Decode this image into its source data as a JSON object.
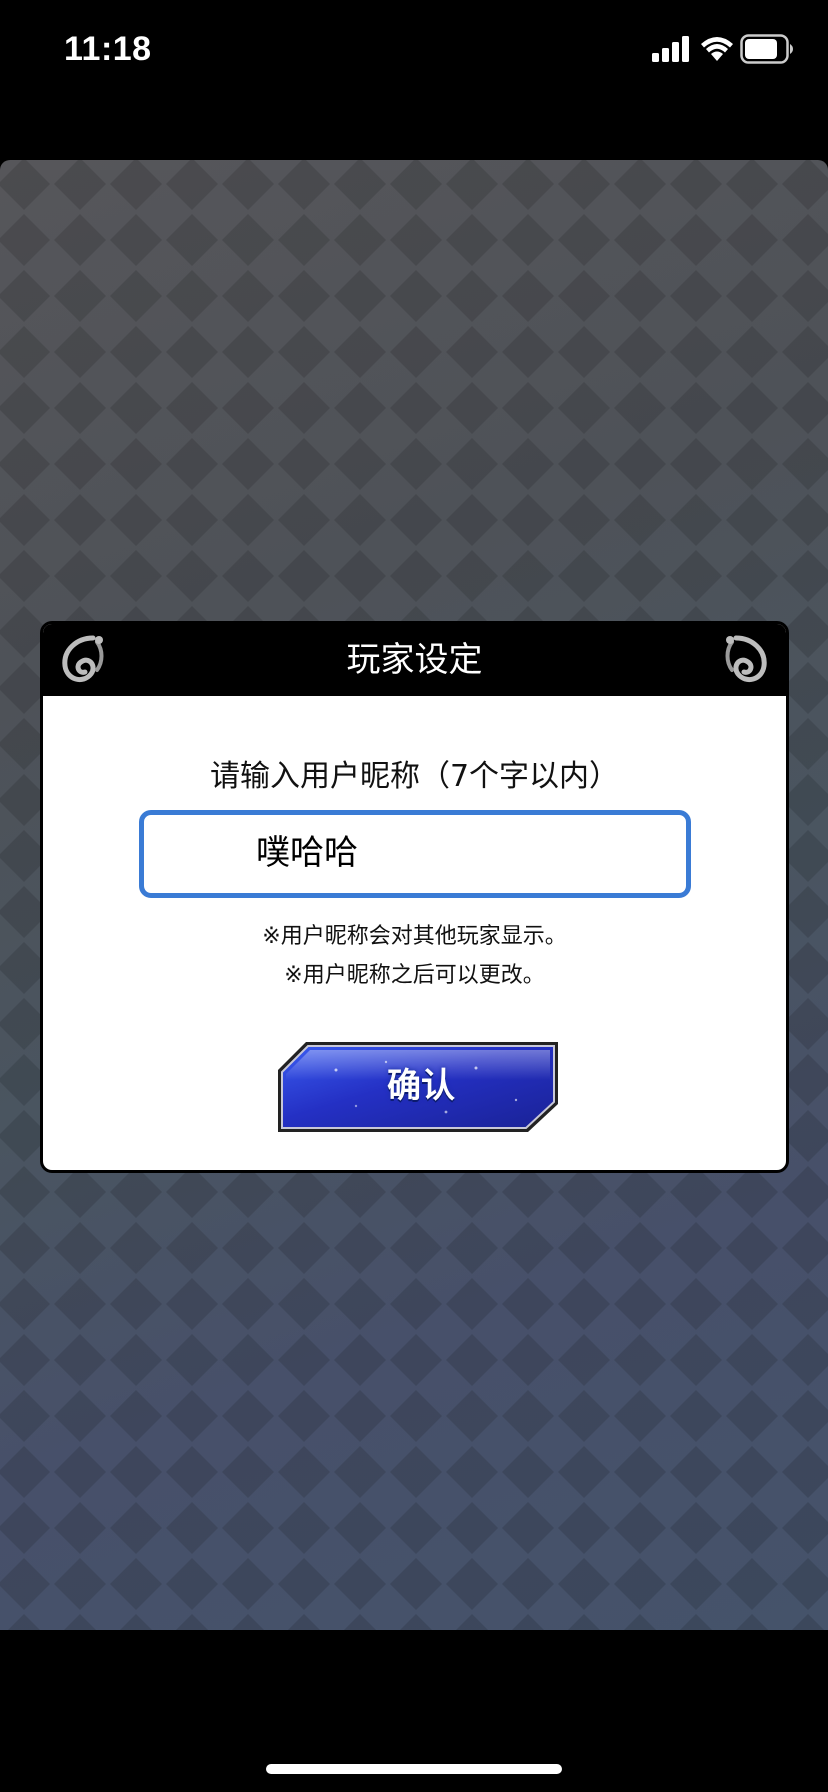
{
  "status_bar": {
    "time": "11:18",
    "icons": [
      "signal-icon",
      "wifi-icon",
      "battery-icon"
    ]
  },
  "dialog": {
    "title": "玩家设定",
    "prompt": "请输入用户昵称（7个字以内）",
    "nickname_value": "噗哈哈",
    "notes": [
      "※用户昵称会对其他玩家显示。",
      "※用户昵称之后可以更改。"
    ],
    "confirm_label": "确认",
    "ornaments": [
      "ornament-left-icon",
      "ornament-right-icon"
    ]
  },
  "colors": {
    "input_border": "#3a7bd5",
    "button_blue": "#2a36c8",
    "header_bg": "#000000"
  }
}
